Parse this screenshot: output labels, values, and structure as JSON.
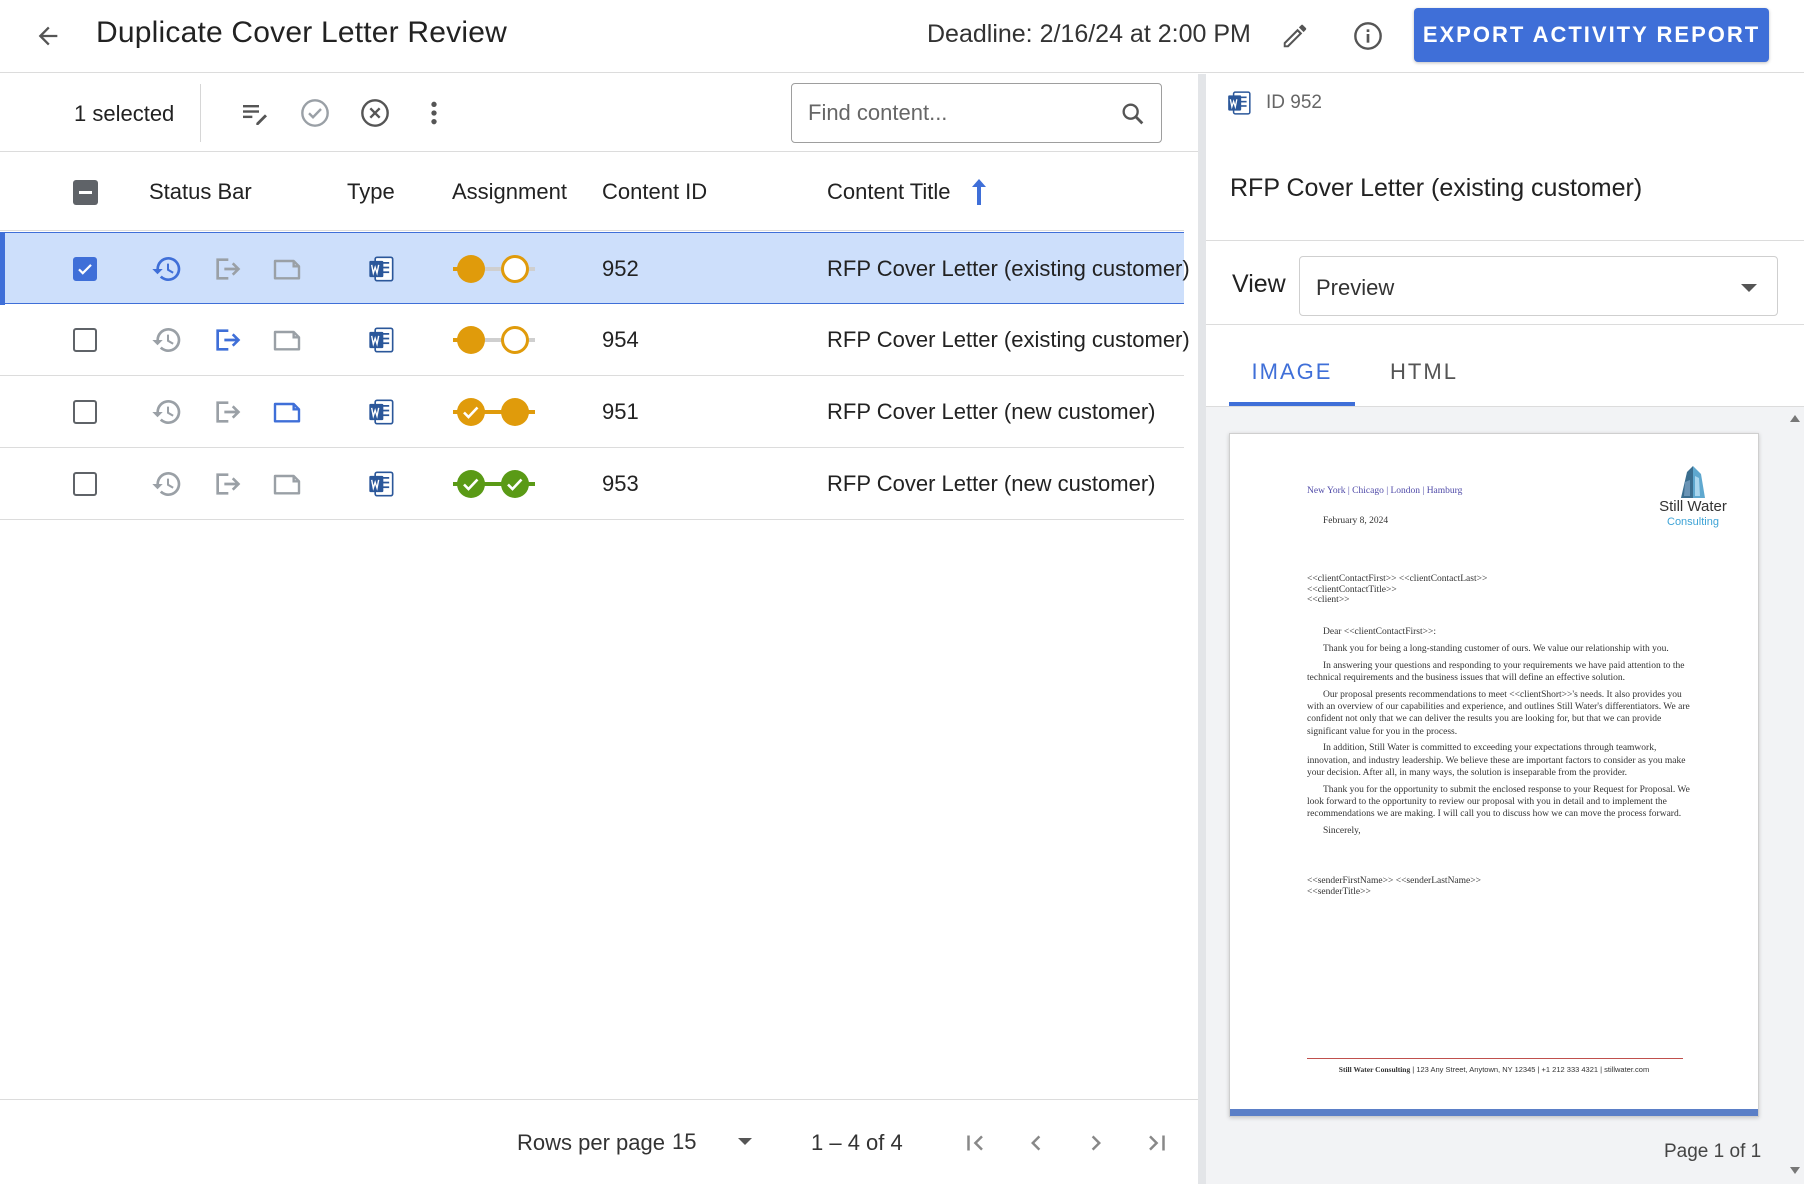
{
  "header": {
    "title": "Duplicate Cover Letter Review",
    "deadline": "Deadline: 2/16/24 at 2:00 PM",
    "export_label": "EXPORT ACTIVITY REPORT"
  },
  "toolbar": {
    "selected_count": "1 selected",
    "search_placeholder": "Find content..."
  },
  "table": {
    "columns": {
      "status_bar": "Status Bar",
      "type": "Type",
      "assignment": "Assignment",
      "content_id": "Content ID",
      "content_title": "Content Title"
    },
    "rows": [
      {
        "content_id": "952",
        "content_title": "RFP Cover Letter (existing customer)",
        "selected": true,
        "active_status": "history",
        "assignment": [
          "pending",
          "open"
        ]
      },
      {
        "content_id": "954",
        "content_title": "RFP Cover Letter (existing customer)",
        "selected": false,
        "active_status": "export",
        "assignment": [
          "pending",
          "open"
        ]
      },
      {
        "content_id": "951",
        "content_title": "RFP Cover Letter (new customer)",
        "selected": false,
        "active_status": "document",
        "assignment": [
          "done-amber",
          "pending"
        ]
      },
      {
        "content_id": "953",
        "content_title": "RFP Cover Letter (new customer)",
        "selected": false,
        "active_status": "none",
        "assignment": [
          "done-green",
          "done-green"
        ]
      }
    ]
  },
  "pagination": {
    "rows_per_page_label": "Rows per page",
    "rows_per_page_value": "15",
    "range": "1 – 4 of 4"
  },
  "detail": {
    "id_label": "ID 952",
    "title": "RFP Cover Letter (existing customer)",
    "view_label": "View",
    "view_value": "Preview",
    "tabs": [
      {
        "label": "IMAGE",
        "active": true
      },
      {
        "label": "HTML",
        "active": false
      }
    ],
    "page_indicator": "Page 1 of 1"
  },
  "letter": {
    "cities": "New York  |  Chicago  |  London  |  Hamburg",
    "date": "February 8, 2024",
    "address": [
      "<<clientContactFirst>> <<clientContactLast>>",
      "<<clientContactTitle>>",
      "<<client>>"
    ],
    "salutation": "Dear <<clientContactFirst>>:",
    "paragraphs": [
      "Thank you for being a long-standing customer of ours. We value our relationship with you.",
      "In answering your questions and responding to your requirements we have paid attention to the technical requirements and the business issues that will define an effective solution.",
      "Our proposal presents recommendations to meet <<clientShort>>'s needs. It also provides you with an overview of our capabilities and experience, and outlines Still Water's differentiators. We are confident not only that we can deliver the results you are looking for, but that we can provide significant value for you in the process.",
      "In addition, Still Water is committed to exceeding your expectations through teamwork, innovation, and industry leadership. We believe these are important factors to consider as you make your decision. After all, in many ways, the solution is inseparable from the provider.",
      "Thank you for the opportunity to submit the enclosed response to your Request for Proposal. We look forward to the opportunity to review our proposal with you in detail and to implement the recommendations we are making. I will call you to discuss how we can move the process forward.",
      "Sincerely,"
    ],
    "signature": [
      "<<senderFirstName>> <<senderLastName>>",
      "<<senderTitle>>"
    ],
    "logo_name": "Still Water",
    "logo_sub": "Consulting",
    "footer_company": "Still Water Consulting",
    "footer_rest": " | 123 Any Street, Anytown, NY 12345 | +1 212 333 4321 | stillwater.com"
  },
  "colors": {
    "accent": "#3f6fd8",
    "amber": "#e09b0b",
    "green": "#5a9a16",
    "selected_row": "#cddffb",
    "word_blue": "#2b579a"
  }
}
